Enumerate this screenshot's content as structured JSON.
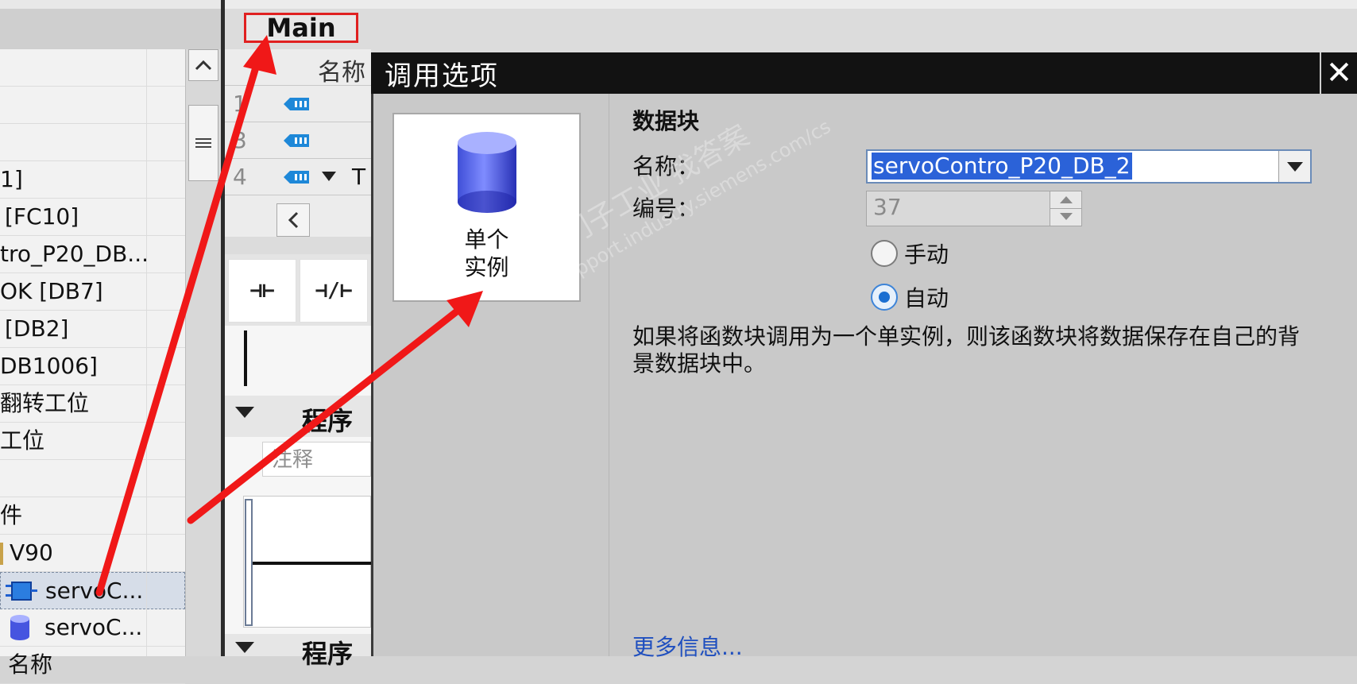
{
  "tree": {
    "items": [
      {
        "label": "",
        "indent": 0
      },
      {
        "label": "",
        "indent": 0
      },
      {
        "label": "",
        "indent": 0
      },
      {
        "label": "1]",
        "indent": 0
      },
      {
        "label": "[FC10]",
        "indent": 6
      },
      {
        "label": "tro_P20_DB...",
        "indent": 0
      },
      {
        "label": "OK [DB7]",
        "indent": 0
      },
      {
        "label": "[DB2]",
        "indent": 6
      },
      {
        "label": "DB1006]",
        "indent": 0
      },
      {
        "label": "翻转工位",
        "indent": 0
      },
      {
        "label": "工位",
        "indent": 0
      },
      {
        "label": "",
        "indent": 0
      },
      {
        "label": "件",
        "indent": 0
      },
      {
        "label": "V90",
        "indent": 12
      },
      {
        "label": "servoC...",
        "indent": 56
      },
      {
        "label": "servoC...",
        "indent": 56
      },
      {
        "label": "名称",
        "indent": 10
      }
    ]
  },
  "editor": {
    "tab_label": "Main",
    "table_header_name": "名称",
    "rows": [
      {
        "num": "1"
      },
      {
        "num": "3"
      },
      {
        "num": "4",
        "label": "T"
      }
    ],
    "ladder_buttons": [
      "⊣⊢",
      "⊣/⊢"
    ],
    "segment_title": "程序",
    "comment_placeholder": "注释",
    "segment_title_2": "程序"
  },
  "dialog": {
    "title": "调用选项",
    "close_glyph": "✕",
    "type_label": "单个\n实例",
    "section_title": "数据块",
    "name_label": "名称：",
    "name_value": "servoContro_P20_DB_2",
    "number_label": "编号：",
    "number_value": "37",
    "radio_manual": "手动",
    "radio_auto": "自动",
    "radio_selected": "auto",
    "description": "如果将函数块调用为一个单实例，则该函数块将数据保存在自己的背景数据块中。",
    "more_info": "更多信息..."
  },
  "watermark": {
    "line1": "西门子工业  找答案",
    "line2": "support.industry.siemens.com/cs"
  },
  "colors": {
    "annotation_red": "#f01818",
    "selection_blue": "#2b62d8",
    "dialog_title_bg": "#121212",
    "link_blue": "#1f4fbf"
  }
}
